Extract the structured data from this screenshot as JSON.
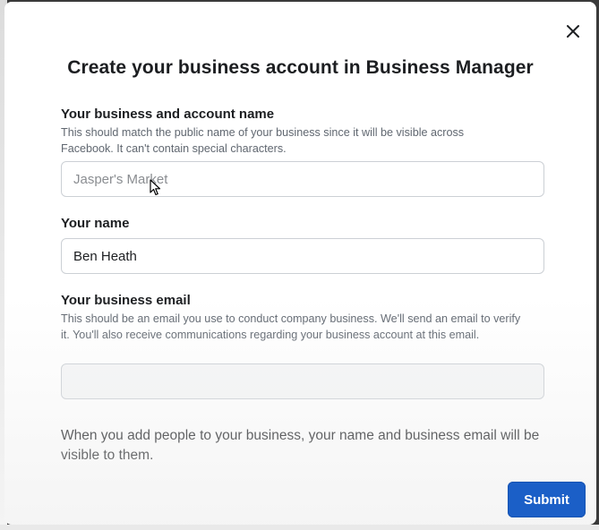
{
  "dialog": {
    "title": "Create your business account in Business Manager",
    "close_icon": "close-icon"
  },
  "business_name": {
    "label": "Your business and account name",
    "help": "This should match the public name of your business since it will be visible across Facebook. It can't contain special characters.",
    "placeholder": "Jasper's Market",
    "value": ""
  },
  "your_name": {
    "label": "Your name",
    "value": "Ben Heath"
  },
  "business_email": {
    "label": "Your business email",
    "help": "This should be an email you use to conduct company business. We'll send an email to verify it. You'll also receive communications regarding your business account at this email.",
    "value": ""
  },
  "notice": "When you add people to your business, your name and business email will be visible to them.",
  "submit_label": "Submit",
  "colors": {
    "primary_button": "#1b5fc7",
    "text": "#1c1e21",
    "help_text": "#606770",
    "input_border": "#ccd0d5"
  }
}
